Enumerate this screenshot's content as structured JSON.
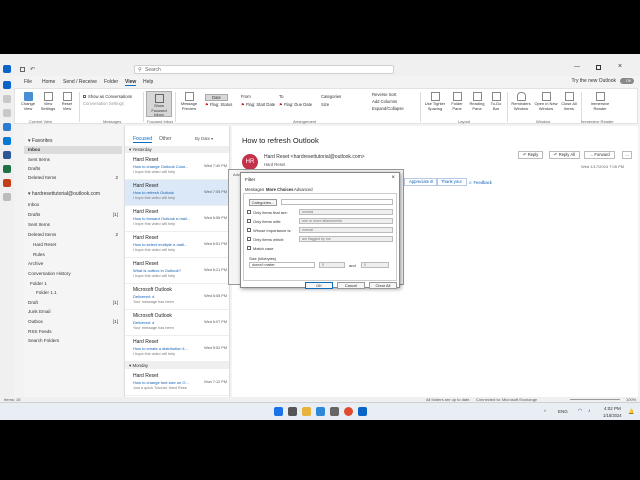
{
  "titlebar": {
    "search_placeholder": "Search"
  },
  "menu": [
    "File",
    "Home",
    "Send / Receive",
    "Folder",
    "View",
    "Help"
  ],
  "try_new": "Try the new Outlook",
  "toggle_state": "Off",
  "ribbon": {
    "change_view": "Change View",
    "view_settings": "View Settings",
    "reset_view": "Reset View",
    "show_conversations": "Show as Conversations",
    "conversation_settings": "Conversation Settings",
    "show_focused": "Show Focused Inbox",
    "message_preview": "Message Preview",
    "arr_date": "Date",
    "arr_from": "From",
    "arr_to": "To",
    "arr_categories": "Categories",
    "arr_flag_status": "Flag: Status",
    "arr_flag_start": "Flag: Start Date",
    "arr_flag_due": "Flag: Due Date",
    "arr_size": "Size",
    "reverse_sort": "Reverse Sort",
    "add_columns": "Add Columns",
    "expand_collapse": "Expand/Collapse",
    "use_tighter": "Use Tighter Spacing",
    "folder_pane": "Folder Pane",
    "reading_pane": "Reading Pane",
    "todo_bar": "To-Do Bar",
    "reminders": "Reminders Window",
    "open_new": "Open in New Window",
    "close_all": "Close All Items",
    "immersive": "Immersive Reader",
    "groups": [
      "Current View",
      "Messages",
      "Focused Inbox",
      "Arrangement",
      "Layout",
      "Window",
      "Immersive Reader"
    ]
  },
  "folders": {
    "favorites": "Favorites",
    "fav_items": [
      {
        "label": "Inbox",
        "count": ""
      },
      {
        "label": "Sent Items",
        "count": ""
      },
      {
        "label": "Drafts",
        "count": ""
      },
      {
        "label": "Deleted Items",
        "count": "2"
      }
    ],
    "account": "hardresettutorial@outlook.com",
    "acct_items": [
      {
        "label": "Inbox",
        "count": ""
      },
      {
        "label": "Drafts",
        "count": "[1]"
      },
      {
        "label": "Sent Items",
        "count": ""
      },
      {
        "label": "Deleted Items",
        "count": "2"
      },
      {
        "label": "Hard Reset",
        "count": ""
      },
      {
        "label": "Rules",
        "count": ""
      },
      {
        "label": "Archive",
        "count": ""
      },
      {
        "label": "Conversation History",
        "count": ""
      },
      {
        "label": "Folder 1",
        "count": ""
      },
      {
        "label": "Folder 1.1",
        "count": ""
      },
      {
        "label": "Draft",
        "count": "[1]"
      },
      {
        "label": "Junk Email",
        "count": ""
      },
      {
        "label": "Outbox",
        "count": "[1]"
      },
      {
        "label": "RSS Feeds",
        "count": ""
      },
      {
        "label": "Search Folders",
        "count": ""
      }
    ]
  },
  "list": {
    "tab_focused": "Focused",
    "tab_other": "Other",
    "sort": "By Date",
    "group_yesterday": "Yesterday",
    "group_monday": "Monday",
    "items": [
      {
        "sender": "Hard Reset",
        "subject": "How to change Outlook Color...",
        "time": "Wed 7:40 PM",
        "preview": "I hope this video will help"
      },
      {
        "sender": "Hard Reset",
        "subject": "How to refresh Outlook",
        "time": "Wed 7:05 PM",
        "preview": "I hope this video will help"
      },
      {
        "sender": "Hard Reset",
        "subject": "How to forward Outlook e-mail...",
        "time": "Wed 6:56 PM",
        "preview": "I hope this video will help"
      },
      {
        "sender": "Hard Reset",
        "subject": "How to select multiple e-mail...",
        "time": "Wed 6:51 PM",
        "preview": "I hope this video will help"
      },
      {
        "sender": "Hard Reset",
        "subject": "What is outbox in Outlook?",
        "time": "Wed 6:21 PM",
        "preview": "I hope this video will help"
      },
      {
        "sender": "Microsoft Outlook",
        "subject": "Delivered: d",
        "time": "Wed 6:08 PM",
        "preview": "Your message has been"
      },
      {
        "sender": "Microsoft Outlook",
        "subject": "Delivered: d",
        "time": "Wed 6:07 PM",
        "preview": "Your message has been"
      },
      {
        "sender": "Hard Reset",
        "subject": "How to create a distribution li...",
        "time": "Wed 5:52 PM",
        "preview": "I hope this video will help"
      },
      {
        "sender": "Hard Reset",
        "subject": "How to change font size on O...",
        "time": "Mon 7:12 PM",
        "preview": "Just a quick Tutorial. Hard Rese"
      }
    ]
  },
  "reading": {
    "subject": "How to refresh Outlook",
    "avatar": "HR",
    "from": "Hard Reset <hardresettutorial@outlook.com>",
    "to": "Hard Reset",
    "reply": "Reply",
    "reply_all": "Reply All",
    "forward": "Forward",
    "date": "Wed 1/17/2024 7:05 PM",
    "quick_thanks": "Thank you!",
    "quick_feedback": "Feedback",
    "quick_appreciate": "Appreciate it!"
  },
  "advanced_find": {
    "title": "Advanced Fi..."
  },
  "filter": {
    "title": "Filter",
    "tabs": [
      "Messages",
      "More Choices",
      "Advanced"
    ],
    "categories_btn": "Categories...",
    "rows": [
      {
        "label": "Only items that are:",
        "value": "unread"
      },
      {
        "label": "Only items with:",
        "value": "one or more attachments"
      },
      {
        "label": "Whose importance is:",
        "value": "normal"
      },
      {
        "label": "Only items which:",
        "value": "are flagged by me"
      }
    ],
    "match_case": "Match case",
    "size_label": "Size (kilobytes)",
    "size_value": "doesn't matter",
    "size_and": "and",
    "size_min": "0",
    "size_max": "0",
    "ok": "OK",
    "cancel": "Cancel",
    "clear_all": "Clear All"
  },
  "status": {
    "items": "Items: 15",
    "all_folders": "All folders are up to date.",
    "connected": "Connected to: Microsoft Exchange",
    "zoom": "100%"
  },
  "taskbar": {
    "lang": "ENG",
    "time": "4:02 PM",
    "date": "1/18/2024"
  },
  "colors": {
    "accent": "#0f6cbd",
    "avatar": "#c4314b",
    "outlook_blue": "#0a64c8"
  }
}
